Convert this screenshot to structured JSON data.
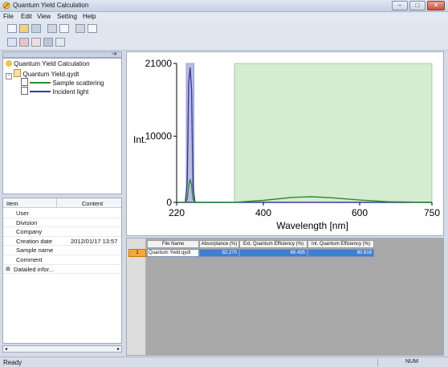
{
  "window": {
    "title": "Quantum Yield Calculation",
    "controls": [
      "–",
      "□",
      "✕"
    ]
  },
  "menu": [
    "File",
    "Edit",
    "View",
    "Setting",
    "Help"
  ],
  "tree": {
    "root": "Quantum Yield Calculation",
    "file": "Quantum Yield.qydt",
    "items": [
      {
        "label": "Sample scattering",
        "color": "#2e8b2e"
      },
      {
        "label": "Incident light",
        "color": "#3a3a9e"
      }
    ]
  },
  "properties": {
    "col_item": "Item",
    "col_content": "Content",
    "rows": [
      {
        "name": "User",
        "value": ""
      },
      {
        "name": "Division",
        "value": ""
      },
      {
        "name": "Company",
        "value": ""
      },
      {
        "name": "Creation date",
        "value": "2012/01/17 13:57"
      },
      {
        "name": "Sample name",
        "value": ""
      },
      {
        "name": "Comment",
        "value": ""
      },
      {
        "name": "Datailed infor...",
        "value": ""
      }
    ]
  },
  "chart_data": {
    "type": "line",
    "xlabel": "Wavelength [nm]",
    "ylabel": "Int.",
    "xlim": [
      220,
      750
    ],
    "ylim": [
      0,
      21000
    ],
    "xticks": [
      220,
      400,
      600,
      750
    ],
    "yticks": [
      0,
      10000,
      21000
    ],
    "excitation_range": [
      240,
      256
    ],
    "emission_range": [
      340,
      750
    ],
    "series": [
      {
        "name": "Incident light",
        "color": "#3a3a9e",
        "x": [
          220,
          238,
          242,
          245,
          248,
          251,
          254,
          258,
          750
        ],
        "y": [
          0,
          0,
          3000,
          18000,
          20400,
          17000,
          2500,
          0,
          0
        ]
      },
      {
        "name": "Sample scattering",
        "color": "#2e8b2e",
        "x": [
          220,
          238,
          242,
          245,
          248,
          251,
          254,
          258,
          340,
          400,
          460,
          500,
          540,
          600,
          660,
          750
        ],
        "y": [
          0,
          0,
          500,
          2500,
          3500,
          2600,
          500,
          0,
          0,
          300,
          750,
          850,
          700,
          350,
          100,
          0
        ]
      }
    ]
  },
  "results_table": {
    "headers": [
      "File Name",
      "Absorptance (%)",
      "Ext. Quantum Efficiency (%)",
      "Int. Quantum Efficiency (%)"
    ],
    "rows": [
      {
        "index": "1",
        "cells": [
          "Quantum Yield.qydt",
          "82.270",
          "66.495",
          "80.818"
        ]
      }
    ]
  },
  "status": {
    "left": "Ready",
    "num": "NUM"
  },
  "colors": {
    "excitation_band": "#b8bde3",
    "emission_band": "#d4ecd0",
    "selected_row": "#3f7fd3",
    "row_index": "#f4a73a"
  }
}
